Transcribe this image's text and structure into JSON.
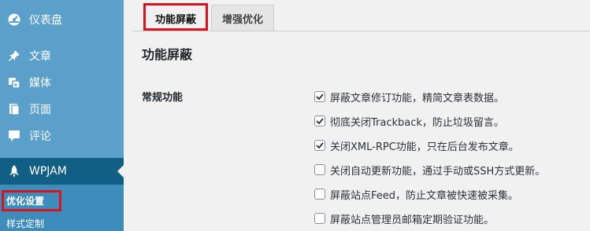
{
  "sidebar": {
    "items": [
      {
        "label": "仪表盘",
        "icon": "dashboard-icon"
      },
      {
        "label": "文章",
        "icon": "pin-icon"
      },
      {
        "label": "媒体",
        "icon": "media-icon"
      },
      {
        "label": "页面",
        "icon": "page-icon"
      },
      {
        "label": "评论",
        "icon": "comment-icon"
      },
      {
        "label": "WPJAM",
        "icon": "wpjam-icon"
      }
    ],
    "submenu": [
      {
        "label": "优化设置"
      },
      {
        "label": "样式定制"
      }
    ]
  },
  "tabs": [
    {
      "label": "功能屏蔽"
    },
    {
      "label": "增强优化"
    }
  ],
  "main": {
    "title": "功能屏蔽",
    "section_label": "常规功能",
    "options": [
      {
        "label": "屏蔽文章修订功能，精简文章表数据。",
        "checked": true
      },
      {
        "label": "彻底关闭Trackback，防止垃圾留言。",
        "checked": true
      },
      {
        "label": "关闭XML-RPC功能，只在后台发布文章。",
        "checked": true
      },
      {
        "label": "关闭自动更新功能，通过手动或SSH方式更新。",
        "checked": false
      },
      {
        "label": "屏蔽站点Feed，防止文章被快速被采集。",
        "checked": false
      },
      {
        "label": "屏蔽站点管理员邮箱定期验证功能。",
        "checked": false
      }
    ]
  },
  "colors": {
    "sidebar_bg": "#5b9fcb",
    "current_bg": "#125f85",
    "submenu_bg": "#3d8cbb",
    "highlight": "#d9131b",
    "content_bg": "#f1f1f1"
  }
}
